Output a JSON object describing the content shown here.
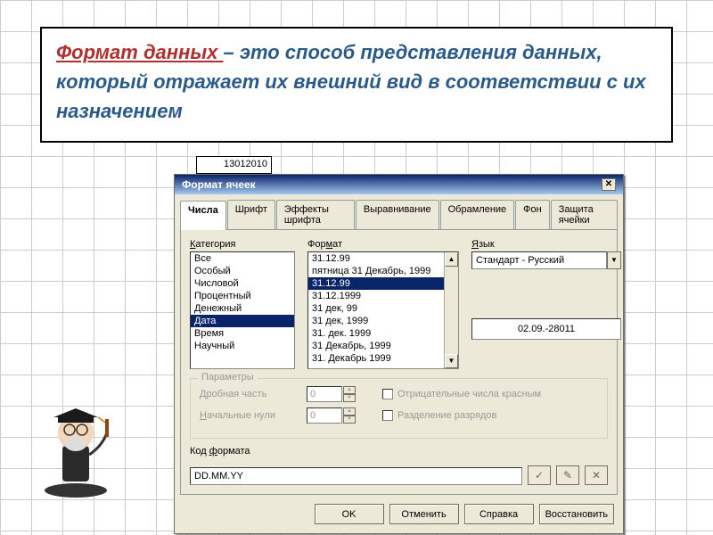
{
  "heading": {
    "term": "Формат  данных ",
    "rest": " –  это  способ  представления данных,  который  отражает  их  внешний  вид  в соответствии  с  их  назначением"
  },
  "cell_value": "13012010",
  "dialog": {
    "title": "Формат ячеек",
    "tabs": [
      "Числа",
      "Шрифт",
      "Эффекты шрифта",
      "Выравнивание",
      "Обрамление",
      "Фон",
      "Защита ячейки"
    ],
    "active_tab": 0,
    "category": {
      "label": "Категория",
      "items": [
        "Все",
        "Особый",
        "Числовой",
        "Процентный",
        "Денежный",
        "Дата",
        "Время",
        "Научный"
      ],
      "selected": 5
    },
    "format": {
      "label": "Формат",
      "items": [
        "31.12.99",
        "пятница 31 Декабрь, 1999",
        "31.12.99",
        "31.12.1999",
        "31 дек, 99",
        "31 дек, 1999",
        "31. дек. 1999",
        "31 Декабрь, 1999",
        "31. Декабрь 1999"
      ],
      "selected": 2
    },
    "language": {
      "label": "Язык",
      "value": "Стандарт - Русский",
      "preview": "02.09.-28011"
    },
    "params": {
      "legend": "Параметры",
      "decimal_label": "Дробная часть",
      "decimal_value": "0",
      "leading_label": "Начальные нули",
      "leading_value": "0",
      "neg_label": "Отрицательные числа красным",
      "sep_label": "Разделение разрядов"
    },
    "code": {
      "label": "Код формата",
      "value": "DD.MM.YY"
    },
    "buttons": {
      "ok": "OK",
      "cancel": "Отменить",
      "help": "Справка",
      "reset": "Восстановить"
    }
  }
}
